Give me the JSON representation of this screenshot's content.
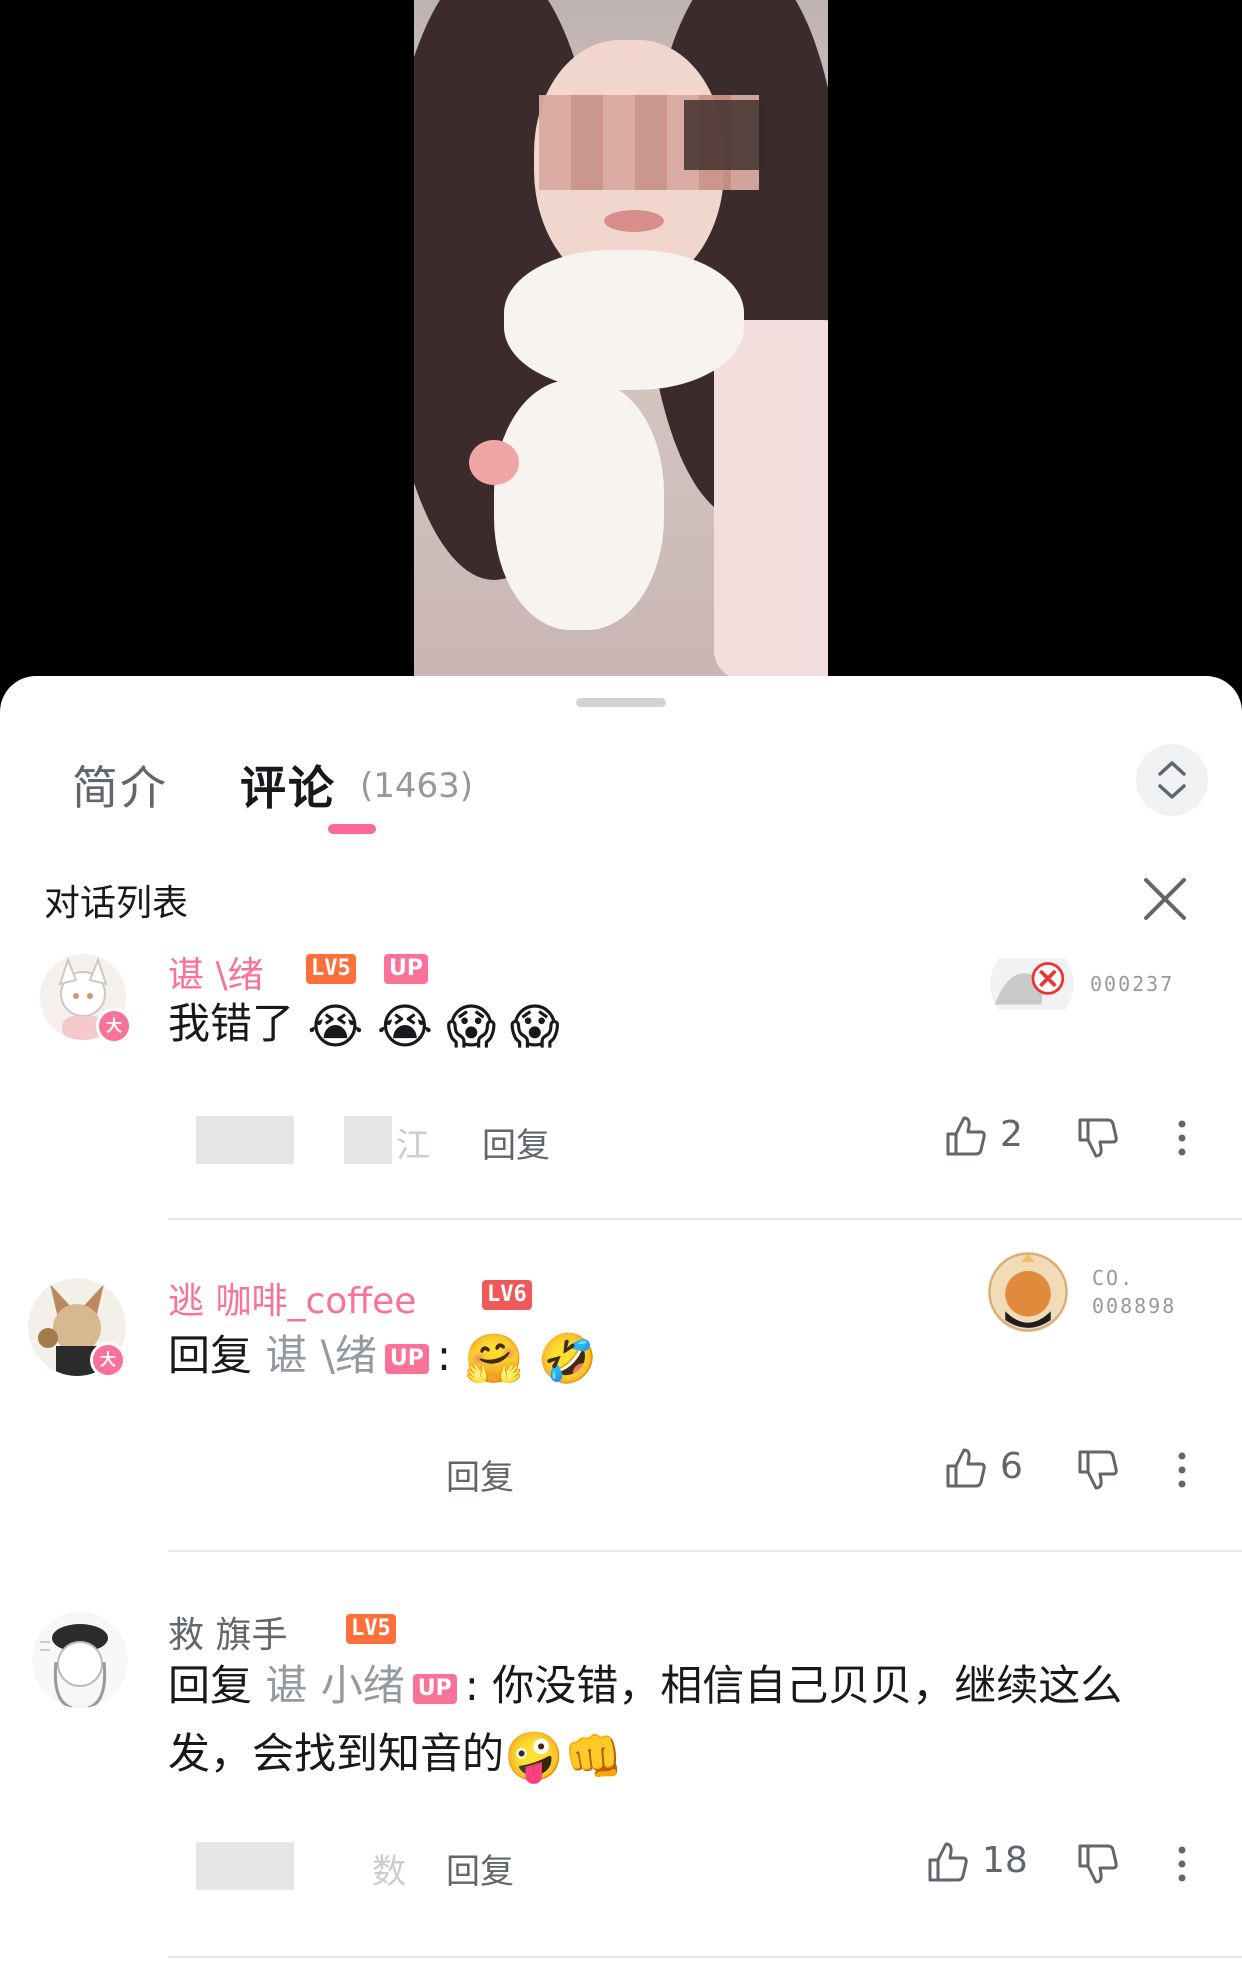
{
  "tabs": {
    "intro": "简介",
    "comments": "评论",
    "comment_count": "(1463)"
  },
  "dialog": {
    "title": "对话列表"
  },
  "comments": [
    {
      "username": "谌  \\绪",
      "level": "LV5",
      "is_up": true,
      "up_label": "UP",
      "text": "我错了",
      "emojis": [
        "😭",
        "😭",
        "😱",
        "😱"
      ],
      "fan_badge": {
        "line1": "",
        "line2": "000237"
      },
      "meta_text": "江",
      "reply_label": "回复",
      "likes": "2"
    },
    {
      "username": "逃  咖啡_coffee",
      "level": "LV6",
      "reply_prefix": "回复",
      "reply_to": "谌  \\绪",
      "up_label": "UP",
      "text": ":",
      "emojis": [
        "🤗",
        "🤣"
      ],
      "fan_badge": {
        "line1": "CO.",
        "line2": "008898"
      },
      "reply_label": "回复",
      "likes": "6"
    },
    {
      "username": "救  旗手",
      "level": "LV5",
      "reply_prefix": "回复",
      "reply_to": "谌  小绪",
      "up_label": "UP",
      "text": ": 你没错，相信自己贝贝，继续这么发，会找到知音的",
      "emojis": [
        "🤪",
        "👊"
      ],
      "meta_text": "数",
      "reply_label": "回复",
      "likes": "18"
    }
  ]
}
